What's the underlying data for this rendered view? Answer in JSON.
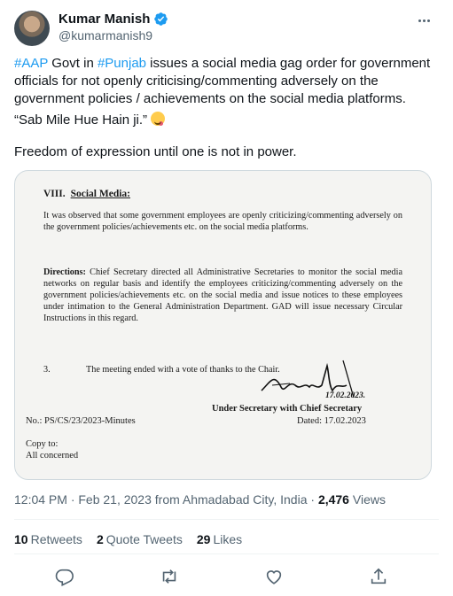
{
  "author": {
    "name": "Kumar Manish",
    "handle": "@kumarmanish9",
    "verified_color": "#1d9bf0"
  },
  "tweet": {
    "line1_hashtag1": "#AAP",
    "line1_mid": " Govt in ",
    "line1_hashtag2": "#Punjab",
    "line1_rest": " issues a social media gag order for government officials for not openly criticising/commenting adversely on the government policies / achievements on the social media platforms.",
    "quote": "“Sab Mile Hue Hain ji.” ",
    "emoji": "face-savoring-food",
    "closing": "Freedom of expression until one is not in power."
  },
  "document": {
    "heading_num": "VIII.",
    "heading_title": "Social Media:",
    "para1": "It was observed that some government employees are openly criticizing/commenting adversely on the government policies/achievements etc. on the social media platforms.",
    "para2_label": "Directions:",
    "para2": " Chief Secretary directed all Administrative Secretaries to monitor the social media networks on regular basis and identify the employees criticizing/commenting adversely on the government policies/achievements etc. on the social media and issue notices to these employees under intimation to the General Administration Department. GAD will issue necessary Circular Instructions in this regard.",
    "item_num": "3.",
    "item_text": "The meeting ended with a vote of thanks to the Chair.",
    "sig_date": "17.02.2023.",
    "designation": "Under Secretary with Chief Secretary",
    "ref_no": "No.: PS/CS/23/2023-Minutes",
    "dated": "Dated: 17.02.2023",
    "copy_to": "Copy to:",
    "concerned": "All concerned"
  },
  "meta": {
    "time": "12:04 PM · Feb 21, 2023 from Ahmadabad City, India · ",
    "views_count": "2,476",
    "views_label": " Views"
  },
  "stats": {
    "retweets_count": "10",
    "retweets_label": "Retweets",
    "quotes_count": "2",
    "quotes_label": "Quote Tweets",
    "likes_count": "29",
    "likes_label": "Likes"
  },
  "actions": [
    "reply-icon",
    "retweet-icon",
    "like-icon",
    "share-icon"
  ]
}
